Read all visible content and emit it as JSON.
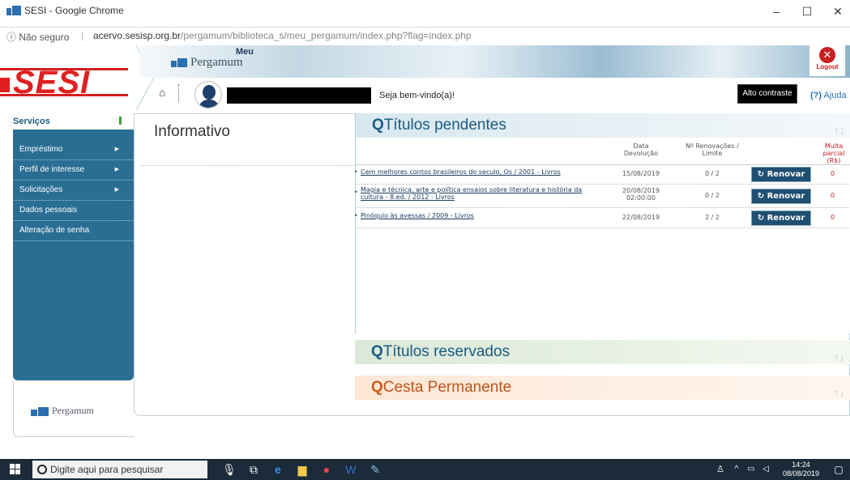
{
  "window": {
    "title": "SESI - Google Chrome",
    "controls": [
      "–",
      "☐",
      "✕"
    ]
  },
  "address": {
    "security": "ⓘ Não seguro",
    "separator": "|",
    "host": "acervo.sesisp.org.br",
    "path": "/pergamum/biblioteca_s/meu_pergamum/index.php?flag=index.php"
  },
  "header": {
    "logo": "SESI",
    "meu": "Meu",
    "pergamum": "Pergamum",
    "logout": "Logout",
    "welcome": "Seja bem-vindo(a)!",
    "contrast": "Alto contraste",
    "help_prefix": "(?)",
    "help": "Ajuda"
  },
  "sidebar": {
    "title": "Serviços",
    "items": [
      {
        "label": "Empréstimo",
        "arrow": "▶"
      },
      {
        "label": "Perfil de interesse",
        "arrow": "▶"
      },
      {
        "label": "Solicitações",
        "arrow": "▶"
      },
      {
        "label": "Dados pessoais",
        "arrow": ""
      },
      {
        "label": "Alteração de senha",
        "arrow": ""
      }
    ],
    "footer": "Pergamum"
  },
  "main": {
    "informativo": "Informativo",
    "pendentes": {
      "title": "Títulos pendentes",
      "columns": {
        "data": "Data Devolução",
        "renovacoes": "Nº Renovações / Limite",
        "multa": "Multa parcial (R$)"
      },
      "rows": [
        {
          "title": "Cem melhores contos brasileiros do seculo, Os / 2001 - Livros",
          "date": "15/08/2019",
          "renov": "0 / 2",
          "button": "Renovar",
          "multa": "0"
        },
        {
          "title": "Magia e técnica, arte e política ensaios sobre literatura e história da cultura - 8.ed. / 2012 - Livros",
          "date": "20/08/2019 02:00:00",
          "renov": "0 / 2",
          "button": "Renovar",
          "multa": "0"
        },
        {
          "title": "Pinóquio às avessas / 2009 - Livros",
          "date": "22/08/2019",
          "renov": "2 / 2",
          "button": "Renovar",
          "multa": "0"
        }
      ]
    },
    "reservados": {
      "title": "Títulos reservados"
    },
    "cesta": {
      "title": "Cesta Permanente"
    }
  },
  "taskbar": {
    "search_placeholder": "Digite aqui para pesquisar",
    "time": "14:24",
    "date": "08/08/2019"
  }
}
